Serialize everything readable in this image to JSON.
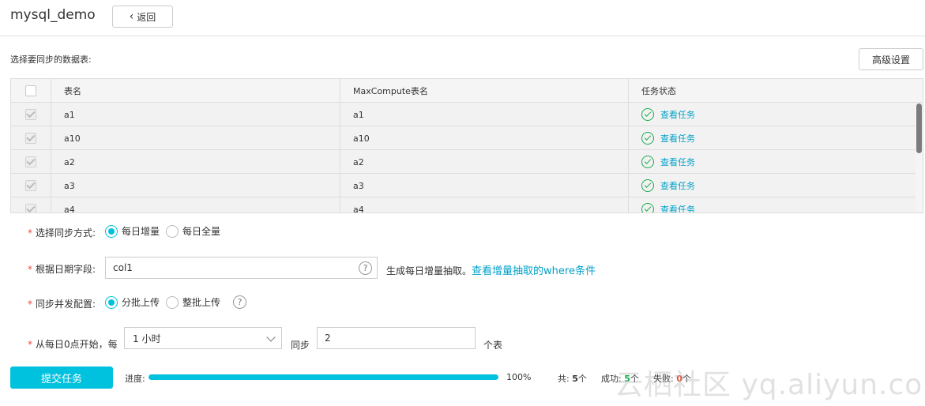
{
  "header": {
    "title": "mysql_demo",
    "back_label": "返回"
  },
  "section_label": "选择要同步的数据表:",
  "advanced_label": "高级设置",
  "table": {
    "columns": [
      "表名",
      "MaxCompute表名",
      "任务状态"
    ],
    "rows": [
      {
        "name": "a1",
        "mc_name": "a1",
        "status": "查看任务"
      },
      {
        "name": "a10",
        "mc_name": "a10",
        "status": "查看任务"
      },
      {
        "name": "a2",
        "mc_name": "a2",
        "status": "查看任务"
      },
      {
        "name": "a3",
        "mc_name": "a3",
        "status": "查看任务"
      },
      {
        "name": "a4",
        "mc_name": "a4",
        "status": "查看任务"
      }
    ]
  },
  "form": {
    "sync_mode": {
      "label": "选择同步方式:",
      "options": [
        "每日增量",
        "每日全量"
      ],
      "selected": "每日增量"
    },
    "date_field": {
      "label": "根据日期字段:",
      "value": "col1",
      "hint": "生成每日增量抽取。",
      "hint_link": "查看增量抽取的where条件"
    },
    "concurrency": {
      "label": "同步并发配置:",
      "options": [
        "分批上传",
        "整批上传"
      ],
      "selected": "分批上传"
    },
    "schedule": {
      "label": "从每日0点开始，每",
      "interval": "1 小时",
      "sync_label": "同步",
      "count": "2",
      "unit": "个表"
    }
  },
  "footer": {
    "submit_label": "提交任务",
    "progress_label": "进度:",
    "progress_text": "100%",
    "progress_fraction": 1.0,
    "total_label": "共:",
    "total": "5",
    "success_label": "成功:",
    "success": "5",
    "fail_label": "失败:",
    "fail": "0",
    "count_unit": "个"
  },
  "watermark": "云栖社区 yq.aliyun.com",
  "colors": {
    "accent": "#00c1de",
    "link": "#00a2ca",
    "success": "#1aab4e",
    "fail": "#e94b3c"
  }
}
